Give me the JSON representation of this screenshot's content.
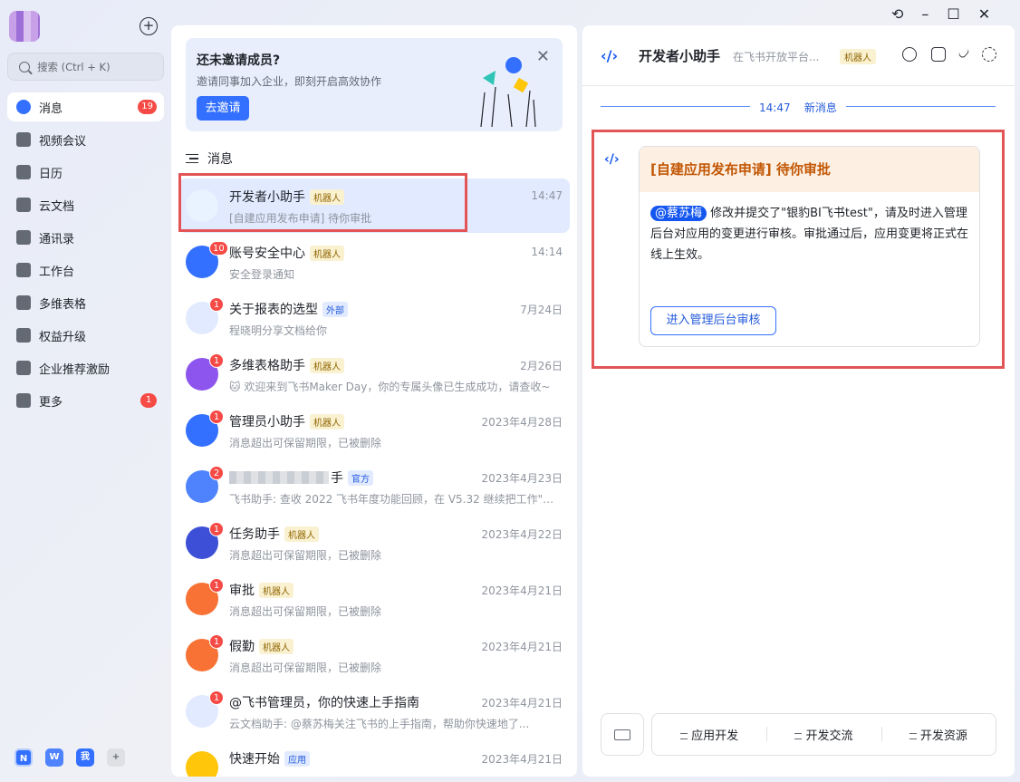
{
  "nav": {
    "search_label": "搜索 (Ctrl + K)",
    "items": [
      {
        "label": "消息",
        "badge": "19"
      },
      {
        "label": "视频会议",
        "badge": ""
      },
      {
        "label": "日历",
        "badge": ""
      },
      {
        "label": "云文档",
        "badge": ""
      },
      {
        "label": "通讯录",
        "badge": ""
      },
      {
        "label": "工作台",
        "badge": ""
      },
      {
        "label": "多维表格",
        "badge": ""
      },
      {
        "label": "权益升级",
        "badge": ""
      },
      {
        "label": "企业推荐激励",
        "badge": ""
      },
      {
        "label": "更多",
        "badge": "1"
      }
    ],
    "bottom_apps": [
      "N",
      "W",
      "我",
      "+"
    ]
  },
  "invite": {
    "title": "还未邀请成员?",
    "desc": "邀请同事加入企业，即刻开启高效协作",
    "button": "去邀请"
  },
  "section_title": "消息",
  "chats": [
    {
      "name": "开发者小助手",
      "tag": "机器人",
      "tag_type": "robot",
      "time": "14:47",
      "preview": "[自建应用发布申请] 待你审批",
      "badge": "",
      "color": "#e8f3ff"
    },
    {
      "name": "账号安全中心",
      "tag": "机器人",
      "tag_type": "robot",
      "time": "14:14",
      "preview": "安全登录通知",
      "badge": "10",
      "color": "#3370ff"
    },
    {
      "name": "关于报表的选型",
      "tag": "外部",
      "tag_type": "ext",
      "time": "7月24日",
      "preview": "程晓明分享文档给你",
      "badge": "1",
      "color": "#e1eaff"
    },
    {
      "name": "多维表格助手",
      "tag": "机器人",
      "tag_type": "robot",
      "time": "2月26日",
      "preview": "🐱 欢迎来到飞书Maker Day，你的专属头像已生成成功，请查收~",
      "badge": "1",
      "color": "#8d55ed"
    },
    {
      "name": "管理员小助手",
      "tag": "机器人",
      "tag_type": "robot",
      "time": "2023年4月28日",
      "preview": "消息超出可保留期限，已被删除",
      "badge": "1",
      "color": "#3370ff"
    },
    {
      "name": "手",
      "tag": "官方",
      "tag_type": "ext",
      "time": "2023年4月23日",
      "preview": "飞书助手: 查收 2022 飞书年度功能回顾，在 V5.32 继续把工作\"画\"...",
      "badge": "2",
      "color": "#4e83fd"
    },
    {
      "name": "任务助手",
      "tag": "机器人",
      "tag_type": "robot",
      "time": "2023年4月22日",
      "preview": "消息超出可保留期限，已被删除",
      "badge": "1",
      "color": "#3c4fd6"
    },
    {
      "name": "审批",
      "tag": "机器人",
      "tag_type": "robot",
      "time": "2023年4月21日",
      "preview": "消息超出可保留期限，已被删除",
      "badge": "1",
      "color": "#f77234"
    },
    {
      "name": "假勤",
      "tag": "机器人",
      "tag_type": "robot",
      "time": "2023年4月21日",
      "preview": "消息超出可保留期限，已被删除",
      "badge": "1",
      "color": "#f77234"
    },
    {
      "name": "@飞书管理员，你的快速上手指南",
      "tag": "",
      "tag_type": "",
      "time": "2023年4月21日",
      "preview": "云文档助手: @蔡苏梅关注飞书的上手指南，帮助你快速地了...",
      "badge": "1",
      "color": "#e1eaff"
    },
    {
      "name": "快速开始",
      "tag": "应用",
      "tag_type": "ext",
      "time": "2023年4月21日",
      "preview": "",
      "badge": "",
      "color": "#ffc60a"
    }
  ],
  "right": {
    "title": "开发者小助手",
    "subtitle": "在飞书开放平台...",
    "tag": "机器人",
    "divider_time": "14:47",
    "divider_label": "新消息",
    "card": {
      "header": "[自建应用发布申请] 待你审批",
      "mention": "@蔡苏梅",
      "body": " 修改并提交了\"银豹BI飞书test\"，请及时进入管理后台对应用的变更进行审核。审批通过后，应用变更将正式在线上生效。",
      "button": "进入管理后台审核"
    },
    "menu": [
      "应用开发",
      "开发交流",
      "开发资源"
    ]
  },
  "colors": {
    "accent": "#3370ff",
    "highlight_box": "#e35456",
    "badge": "#f54a45"
  }
}
